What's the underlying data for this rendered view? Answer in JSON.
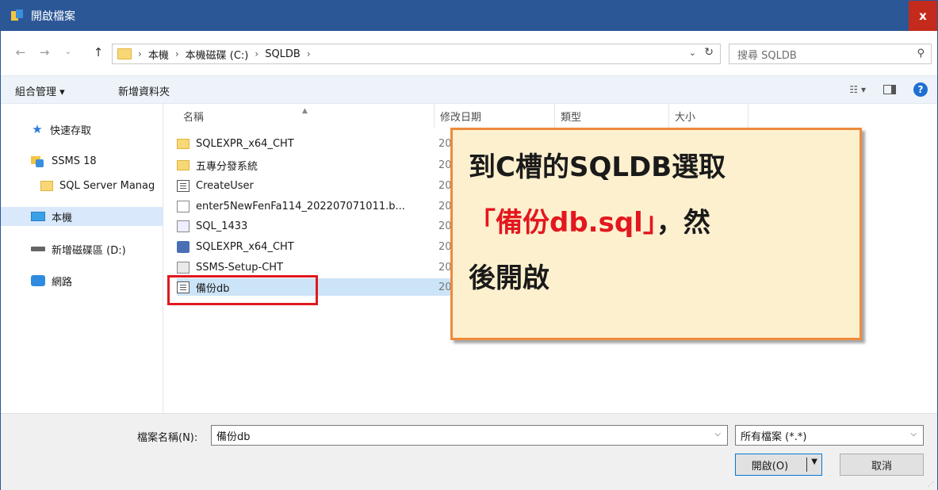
{
  "window": {
    "title": "開啟檔案",
    "close_label": "x"
  },
  "address": {
    "crumbs": [
      "本機",
      "本機磁碟 (C:)",
      "SQLDB"
    ],
    "search_placeholder": "搜尋 SQLDB"
  },
  "toolbar": {
    "organize": "組合管理 ▾",
    "new_folder": "新增資料夾"
  },
  "nav": {
    "quick_access": "快速存取",
    "ssms": "SSMS 18",
    "sql_server": "SQL Server Manag",
    "this_pc": "本機",
    "drive_d": "新增磁碟區 (D:)",
    "network": "網路"
  },
  "columns": {
    "name": "名稱",
    "date": "修改日期",
    "type": "類型",
    "size": "大小"
  },
  "files": [
    {
      "name": "SQLEXPR_x64_CHT",
      "date": "20",
      "icon": "folder-icon"
    },
    {
      "name": "五專分發系統",
      "date": "20",
      "icon": "folder-icon"
    },
    {
      "name": "CreateUser",
      "date": "20",
      "icon": "document-icon"
    },
    {
      "name": "enter5NewFenFa114_202207071011.b...",
      "date": "20",
      "icon": "blank-file-icon"
    },
    {
      "name": "SQL_1433",
      "date": "20",
      "icon": "shortcut-icon"
    },
    {
      "name": "SQLEXPR_x64_CHT",
      "date": "20",
      "icon": "installer-icon"
    },
    {
      "name": "SSMS-Setup-CHT",
      "date": "20",
      "icon": "setup-icon"
    },
    {
      "name": "備份db",
      "date": "20",
      "icon": "document-icon"
    }
  ],
  "callout": {
    "line1": "到C槽的SQLDB選取",
    "line2_red": "「備份db.sql」",
    "line2_black": "，然",
    "line3": "後開啟"
  },
  "bottom": {
    "filename_label": "檔案名稱(N):",
    "filename_value": "備份db",
    "filter_value": "所有檔案 (*.*)",
    "open_label": "開啟(O)",
    "cancel_label": "取消"
  },
  "colors": {
    "titlebar": "#2b5797",
    "close": "#c42b1c",
    "highlight": "#e0181e",
    "callout_border": "#ef8a3c",
    "callout_bg": "#fdf0cf"
  }
}
